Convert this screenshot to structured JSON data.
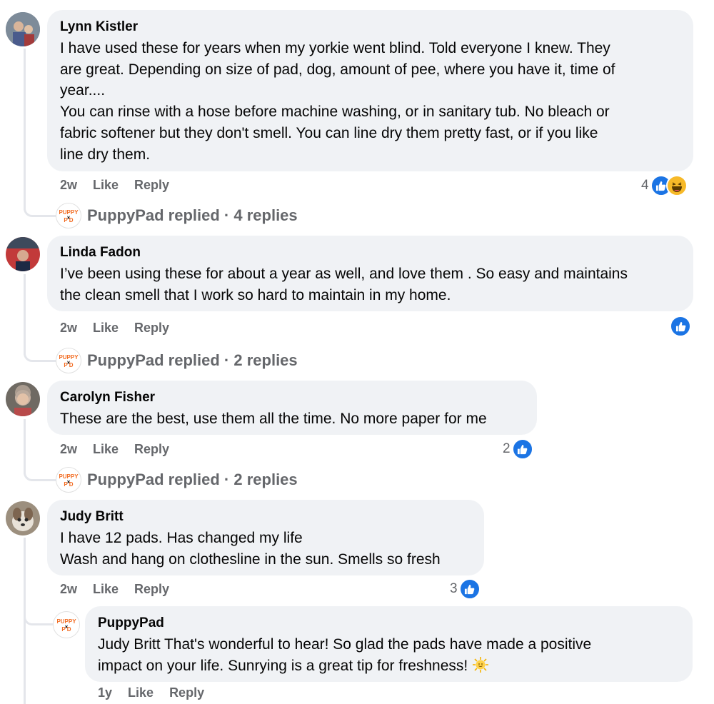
{
  "comments": [
    {
      "author": "Lynn Kistler",
      "text": "I have used these for years when my yorkie went blind. Told everyone I knew. They\nare great. Depending on size of pad, dog, amount of pee, where you have it, time of\nyear....\nYou can rinse with a hose before machine washing, or in sanitary tub. No bleach or\nfabric softener but they don't smell. You can line dry them pretty fast, or if you like\nline dry them.",
      "time": "2w",
      "like": "Like",
      "reply": "Reply",
      "reaction_count": "4",
      "reactions": [
        "like-icon",
        "haha-icon"
      ],
      "replied": "PuppyPad replied · 4 replies"
    },
    {
      "author": "Linda Fadon",
      "text": "I’ve been using these for about a year as well, and love them . So easy and maintains\nthe clean smell that I work so hard to maintain in my home.",
      "time": "2w",
      "like": "Like",
      "reply": "Reply",
      "reaction_count": "",
      "reactions": [
        "like-icon"
      ],
      "replied": "PuppyPad replied · 2 replies"
    },
    {
      "author": "Carolyn Fisher",
      "text": "These are the best, use them all the time. No more paper for me",
      "time": "2w",
      "like": "Like",
      "reply": "Reply",
      "reaction_count": "2",
      "reactions": [
        "like-icon"
      ],
      "replied": "PuppyPad replied · 2 replies"
    },
    {
      "author": "Judy Britt",
      "text": "I have 12 pads. Has changed my life\nWash and hang on clothesline in the sun. Smells so fresh",
      "time": "2w",
      "like": "Like",
      "reply": "Reply",
      "reaction_count": "3",
      "reactions": [
        "like-icon"
      ]
    }
  ],
  "reply": {
    "author": "PuppyPad",
    "text": "Judy Britt That's wonderful to hear! So glad the pads have made a positive\nimpact on your life. Sunrying is a great tip for freshness!",
    "emoji": "sun-emoji",
    "time": "1y",
    "like": "Like",
    "reply": "Reply"
  },
  "logo_text": "PUPPY PAD",
  "colors": {
    "like_blue": "#1b74e4",
    "bubble": "#f0f2f5",
    "meta": "#65676b",
    "brand_orange": "#f26b21"
  }
}
